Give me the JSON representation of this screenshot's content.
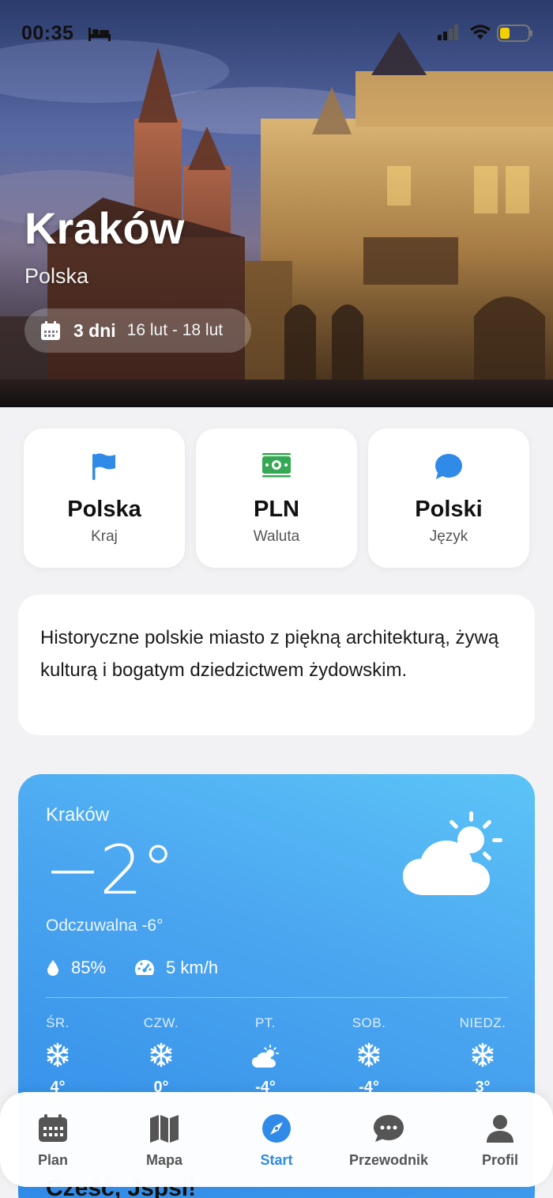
{
  "status_bar": {
    "time": "00:35"
  },
  "hero": {
    "city": "Kraków",
    "country": "Polska",
    "duration": "3 dni",
    "date_range": "16 lut - 18 lut"
  },
  "info_cards": [
    {
      "value": "Polska",
      "label": "Kraj",
      "icon": "flag-icon",
      "color": "#2f8ae8"
    },
    {
      "value": "PLN",
      "label": "Waluta",
      "icon": "banknote-icon",
      "color": "#34a853"
    },
    {
      "value": "Polski",
      "label": "Język",
      "icon": "speech-bubble-icon",
      "color": "#2f8ae8"
    }
  ],
  "description": "Historyczne polskie miasto z piękną architekturą, żywą kulturą i bogatym dziedzictwem żydowskim.",
  "weather": {
    "city": "Kraków",
    "temperature": "−2°",
    "feels_like": "Odczuwalna -6°",
    "humidity": "85%",
    "wind": "5 km/h",
    "icon": "partly-sunny-icon",
    "forecast": [
      {
        "day": "ŚR.",
        "temp": "4°",
        "icon": "snowflake-icon"
      },
      {
        "day": "CZW.",
        "temp": "0°",
        "icon": "snowflake-icon"
      },
      {
        "day": "PT.",
        "temp": "-4°",
        "icon": "partly-sunny-icon"
      },
      {
        "day": "SOB.",
        "temp": "-4°",
        "icon": "snowflake-icon"
      },
      {
        "day": "NIEDZ.",
        "temp": "3°",
        "icon": "snowflake-icon"
      }
    ]
  },
  "greeting": "Cześć, Jspsi!",
  "tab_bar": {
    "active": "Start",
    "accent_color": "#2f8ae8",
    "tabs": [
      {
        "label": "Plan",
        "icon": "calendar-icon"
      },
      {
        "label": "Mapa",
        "icon": "map-icon"
      },
      {
        "label": "Start",
        "icon": "compass-icon"
      },
      {
        "label": "Przewodnik",
        "icon": "chat-bubble-icon"
      },
      {
        "label": "Profil",
        "icon": "person-icon"
      }
    ]
  }
}
